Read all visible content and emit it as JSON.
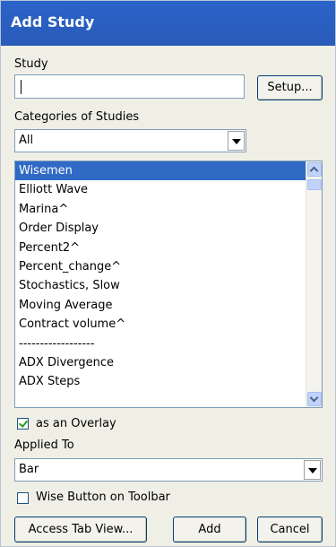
{
  "window": {
    "title": "Add Study"
  },
  "study": {
    "label": "Study",
    "value": "",
    "setup_label": "Setup..."
  },
  "categories": {
    "label": "Categories of Studies",
    "selected": "All"
  },
  "studies_list": {
    "items": [
      "Wisemen",
      "Elliott Wave",
      "Marina^",
      "Order Display",
      "Percent2^",
      "Percent_change^",
      "Stochastics, Slow",
      "Moving Average",
      "Contract volume^",
      "------------------",
      "ADX Divergence",
      "ADX Steps"
    ],
    "selected_index": 0
  },
  "overlay": {
    "label": "as an Overlay",
    "checked": true
  },
  "applied_to": {
    "label": "Applied To",
    "selected": "Bar"
  },
  "wise_button": {
    "label": "Wise Button on Toolbar",
    "checked": false
  },
  "buttons": {
    "access_tab_view": "Access Tab View...",
    "add": "Add",
    "cancel": "Cancel"
  },
  "colors": {
    "title_bar": "#2a5bb8",
    "selection": "#316ac5",
    "dialog_bg": "#f0efe6"
  }
}
